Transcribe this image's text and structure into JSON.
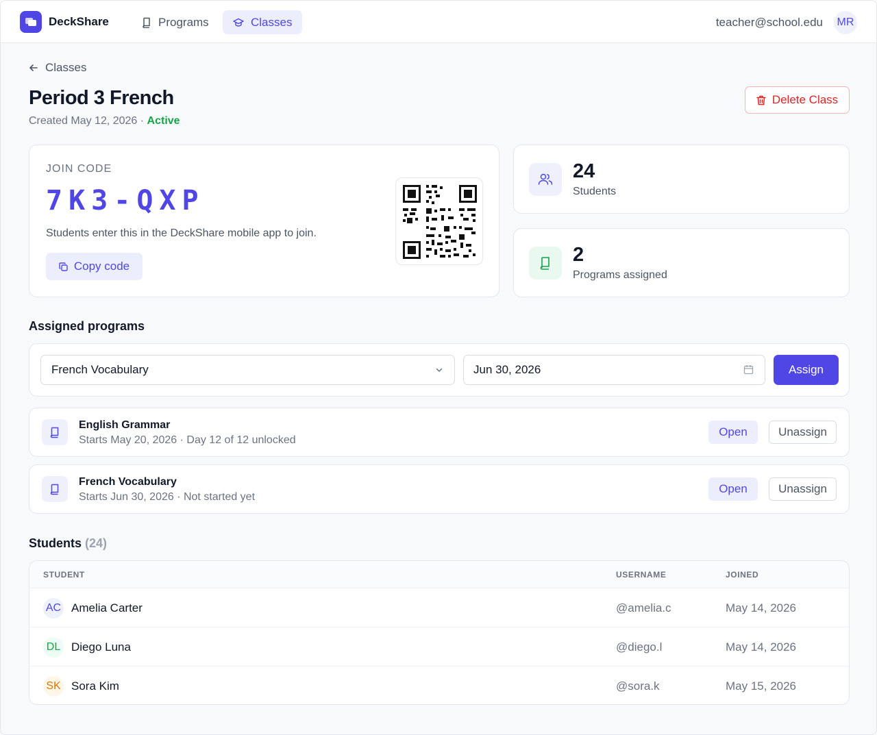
{
  "nav": {
    "brand": "DeckShare",
    "tabs": [
      {
        "label": "Programs",
        "icon": "book-icon"
      },
      {
        "label": "Classes",
        "icon": "graduation-cap-icon"
      }
    ],
    "user_email": "teacher@school.edu",
    "user_initials": "MR"
  },
  "header": {
    "back_label": "Classes",
    "title": "Period 3 French",
    "created": "Created May 12, 2026",
    "separator": " · ",
    "status": "Active",
    "delete_label": "Delete Class"
  },
  "join": {
    "label": "JOIN CODE",
    "code": "7K3-QXP",
    "help": "Students enter this in the DeckShare mobile app to join.",
    "copy_label": "Copy code"
  },
  "stats": [
    {
      "value": "24",
      "label": "Students",
      "icon": "users-icon"
    },
    {
      "value": "2",
      "label": "Programs assigned",
      "icon": "book-icon"
    }
  ],
  "assigned": {
    "title": "Assigned programs",
    "select_value": "French Vocabulary",
    "date_value": "Jun 30, 2026",
    "assign_label": "Assign",
    "programs": [
      {
        "name": "English Grammar",
        "meta": "Starts May 20, 2026 · Day 12 of 12 unlocked",
        "open_label": "Open",
        "unassign_label": "Unassign"
      },
      {
        "name": "French Vocabulary",
        "meta": "Starts Jun 30, 2026 · Not started yet",
        "open_label": "Open",
        "unassign_label": "Unassign"
      }
    ]
  },
  "students": {
    "title": "Students",
    "count": "(24)",
    "columns": [
      "STUDENT",
      "USERNAME",
      "JOINED"
    ],
    "rows": [
      {
        "initials": "AC",
        "name": "Amelia Carter",
        "username": "@amelia.c",
        "joined": "May 14, 2026",
        "color": "#4f46e5",
        "bg": "#eef0fb"
      },
      {
        "initials": "DL",
        "name": "Diego Luna",
        "username": "@diego.l",
        "joined": "May 14, 2026",
        "color": "#16a34a",
        "bg": "#ecfdf3"
      },
      {
        "initials": "SK",
        "name": "Sora Kim",
        "username": "@sora.k",
        "joined": "May 15, 2026",
        "color": "#d97706",
        "bg": "#fef6e7"
      }
    ]
  },
  "colors": {
    "accent": "#4f46e5",
    "success": "#16a34a",
    "danger": "#dc2626"
  }
}
